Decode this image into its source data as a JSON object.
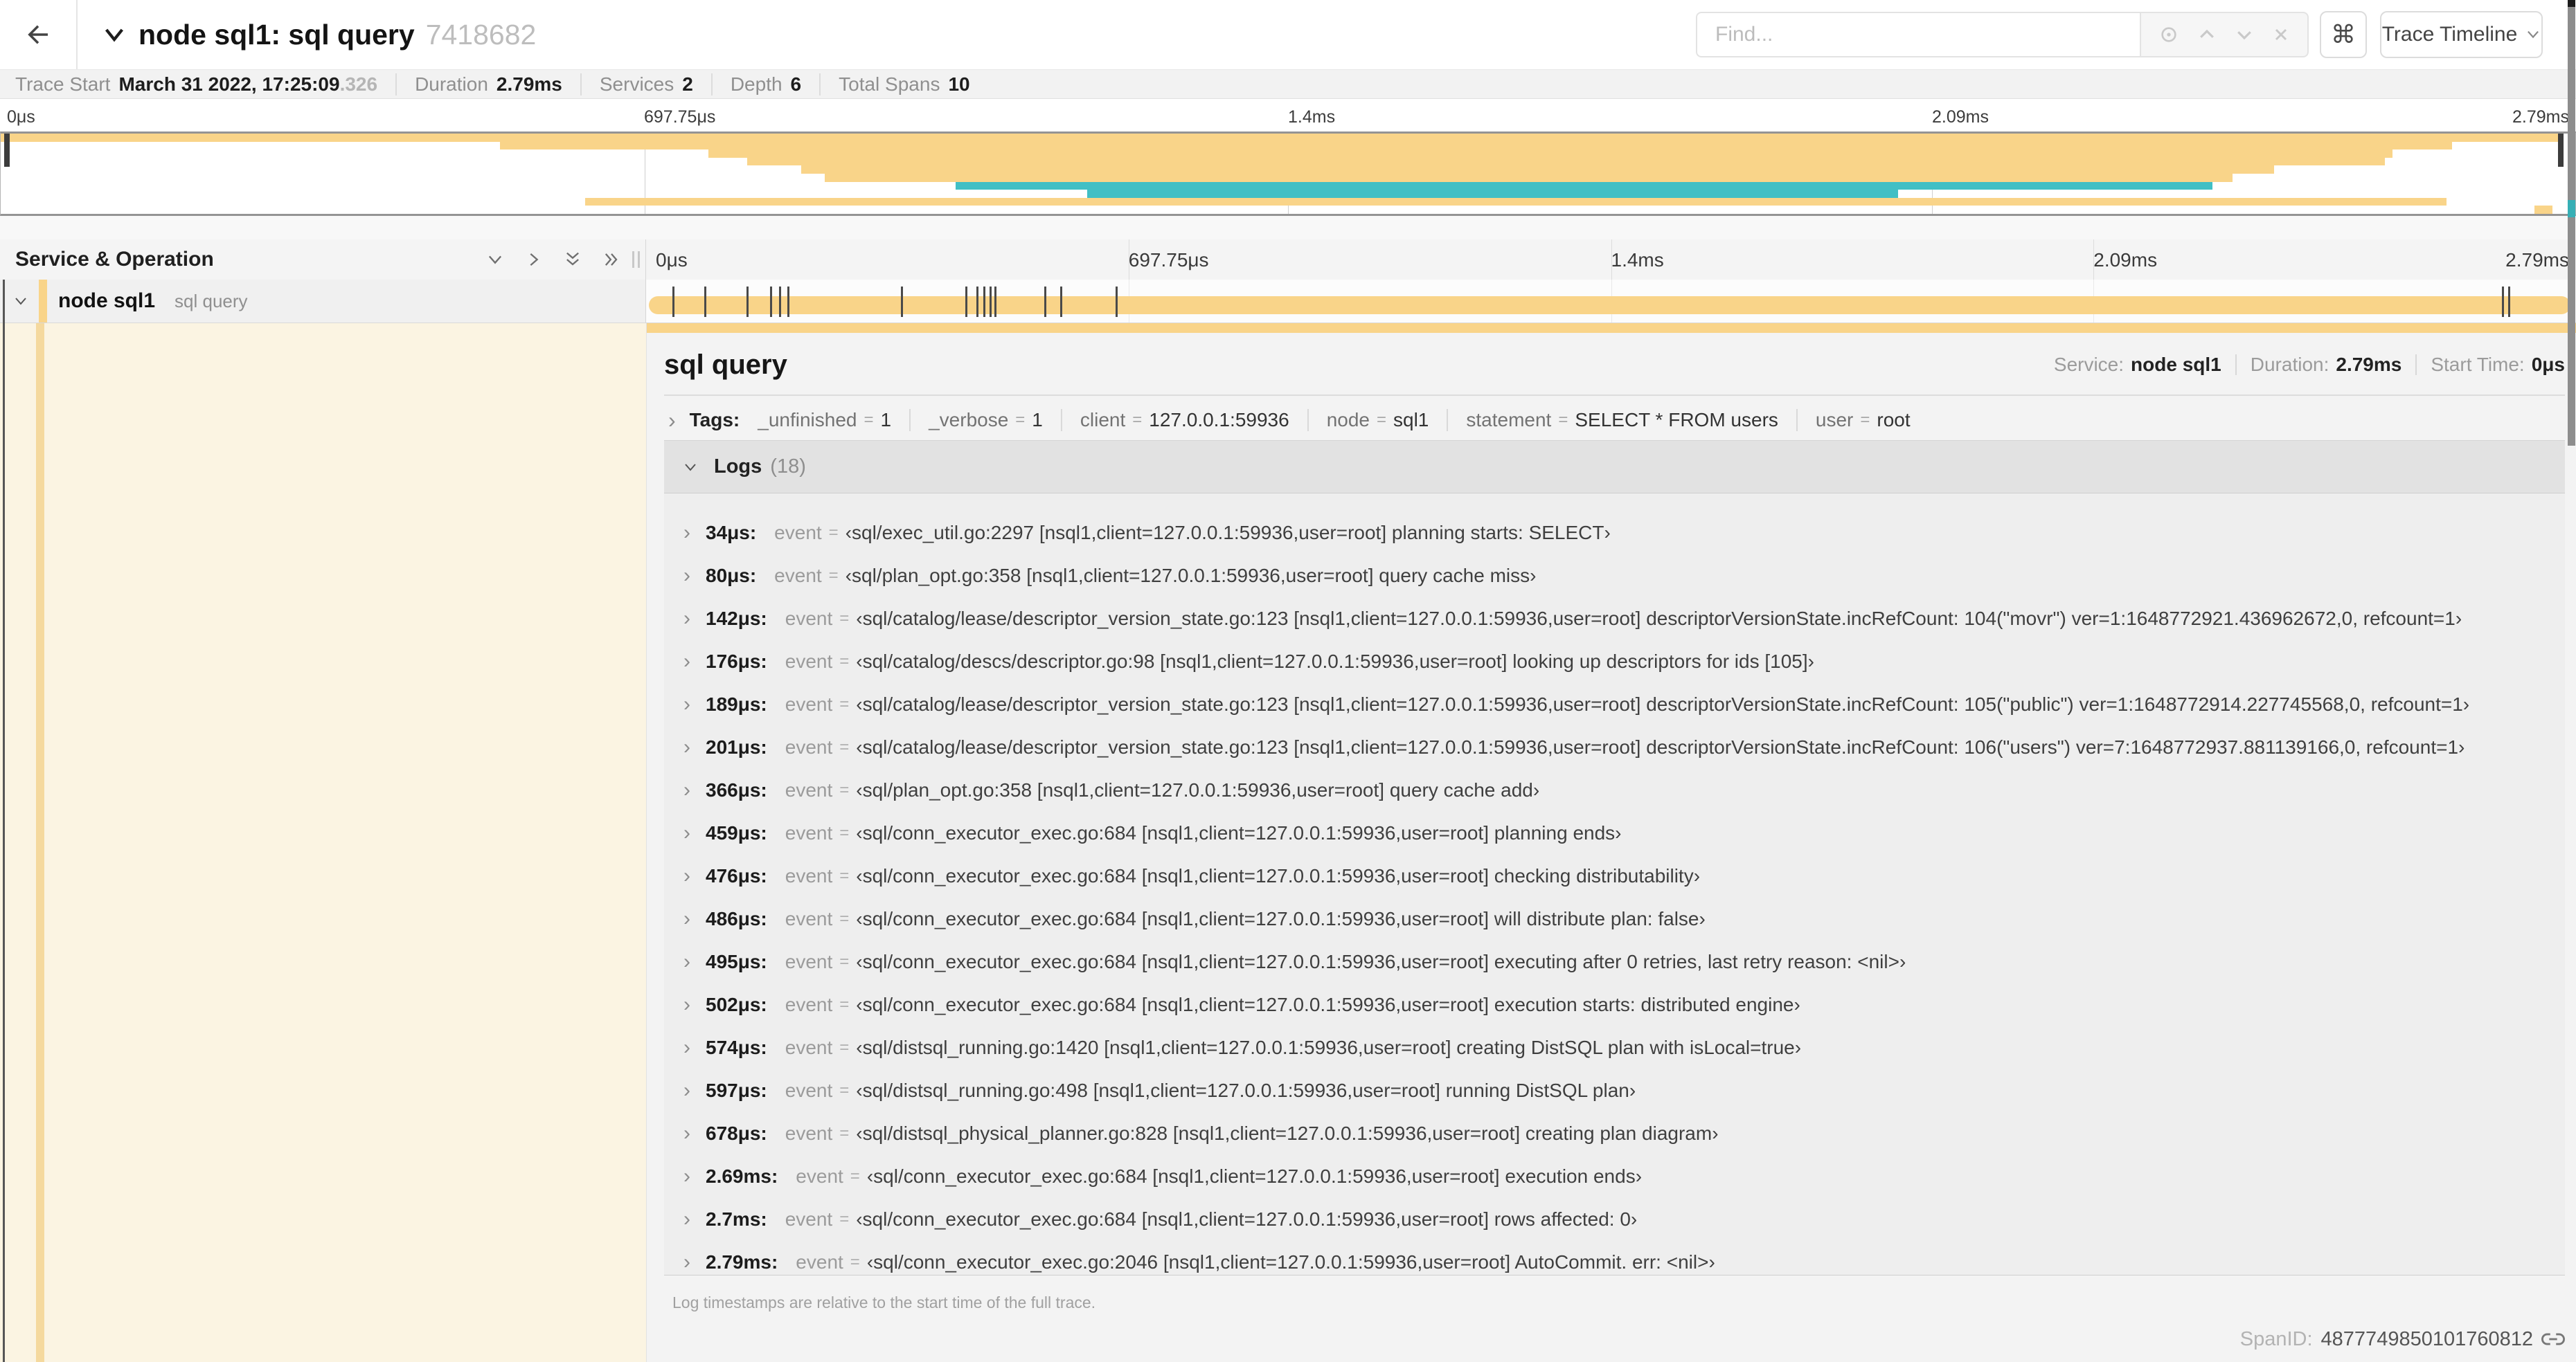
{
  "colors": {
    "tan": "#f9d489",
    "teal": "#41bfc5",
    "cream": "#fbf4e2"
  },
  "header": {
    "back_icon": "arrow-left",
    "collapse_icon": "chevron-down",
    "title": "node sql1: sql query",
    "trace_id": "7418682",
    "find_placeholder": "Find...",
    "shortcut_icon": "⌘",
    "view_selector": "Trace Timeline"
  },
  "trace_meta": {
    "items": [
      {
        "label": "Trace Start",
        "value": "March 31 2022, 17:25:09",
        "suffix": ".326"
      },
      {
        "label": "Duration",
        "value": "2.79ms"
      },
      {
        "label": "Services",
        "value": "2"
      },
      {
        "label": "Depth",
        "value": "6"
      },
      {
        "label": "Total Spans",
        "value": "10"
      }
    ]
  },
  "timeline": {
    "axis_ticks": [
      "0μs",
      "697.75μs",
      "1.4ms",
      "2.09ms",
      "2.79ms"
    ]
  },
  "minimap": {
    "bars": [
      {
        "start": 0,
        "end": 99.5,
        "color": "tan"
      },
      {
        "start": 19.4,
        "end": 95.2,
        "color": "tan"
      },
      {
        "start": 27.5,
        "end": 92.9,
        "color": "tan"
      },
      {
        "start": 29.0,
        "end": 92.6,
        "color": "tan"
      },
      {
        "start": 31.1,
        "end": 88.3,
        "color": "tan"
      },
      {
        "start": 32.0,
        "end": 86.7,
        "color": "tan"
      },
      {
        "start": 37.1,
        "end": 85.9,
        "color": "teal"
      },
      {
        "start": 42.2,
        "end": 73.7,
        "color": "teal"
      },
      {
        "start": 22.7,
        "end": 95.0,
        "color": "tan"
      },
      {
        "start": 98.4,
        "end": 99.1,
        "color": "tan"
      }
    ]
  },
  "timeline_header": {
    "title": "Service & Operation"
  },
  "span_row": {
    "service": "node sql1",
    "operation": "sql query",
    "duration_us": 2790,
    "log_marks_us": [
      34,
      80,
      142,
      176,
      189,
      201,
      366,
      459,
      476,
      486,
      495,
      502,
      574,
      597,
      678,
      2690,
      2700,
      2790
    ]
  },
  "detail": {
    "operation": "sql query",
    "meta": [
      {
        "label": "Service:",
        "value": "node sql1"
      },
      {
        "label": "Duration:",
        "value": "2.79ms"
      },
      {
        "label": "Start Time:",
        "value": "0μs"
      }
    ],
    "tags": {
      "label": "Tags:",
      "items": [
        {
          "key": "_unfinished",
          "value": "1"
        },
        {
          "key": "_verbose",
          "value": "1"
        },
        {
          "key": "client",
          "value": "127.0.0.1:59936"
        },
        {
          "key": "node",
          "value": "sql1"
        },
        {
          "key": "statement",
          "value": "SELECT * FROM users"
        },
        {
          "key": "user",
          "value": "root"
        }
      ]
    },
    "logs": {
      "title": "Logs",
      "count": "(18)",
      "entries": [
        {
          "time": "34μs:",
          "key": "event",
          "value": "‹sql/exec_util.go:2297 [nsql1,client=127.0.0.1:59936,user=root] planning starts: SELECT›"
        },
        {
          "time": "80μs:",
          "key": "event",
          "value": "‹sql/plan_opt.go:358 [nsql1,client=127.0.0.1:59936,user=root] query cache miss›"
        },
        {
          "time": "142μs:",
          "key": "event",
          "value": "‹sql/catalog/lease/descriptor_version_state.go:123 [nsql1,client=127.0.0.1:59936,user=root] descriptorVersionState.incRefCount: 104(\"movr\") ver=1:1648772921.436962672,0, refcount=1›"
        },
        {
          "time": "176μs:",
          "key": "event",
          "value": "‹sql/catalog/descs/descriptor.go:98 [nsql1,client=127.0.0.1:59936,user=root] looking up descriptors for ids [105]›"
        },
        {
          "time": "189μs:",
          "key": "event",
          "value": "‹sql/catalog/lease/descriptor_version_state.go:123 [nsql1,client=127.0.0.1:59936,user=root] descriptorVersionState.incRefCount: 105(\"public\") ver=1:1648772914.227745568,0, refcount=1›"
        },
        {
          "time": "201μs:",
          "key": "event",
          "value": "‹sql/catalog/lease/descriptor_version_state.go:123 [nsql1,client=127.0.0.1:59936,user=root] descriptorVersionState.incRefCount: 106(\"users\") ver=7:1648772937.881139166,0, refcount=1›"
        },
        {
          "time": "366μs:",
          "key": "event",
          "value": "‹sql/plan_opt.go:358 [nsql1,client=127.0.0.1:59936,user=root] query cache add›"
        },
        {
          "time": "459μs:",
          "key": "event",
          "value": "‹sql/conn_executor_exec.go:684 [nsql1,client=127.0.0.1:59936,user=root] planning ends›"
        },
        {
          "time": "476μs:",
          "key": "event",
          "value": "‹sql/conn_executor_exec.go:684 [nsql1,client=127.0.0.1:59936,user=root] checking distributability›"
        },
        {
          "time": "486μs:",
          "key": "event",
          "value": "‹sql/conn_executor_exec.go:684 [nsql1,client=127.0.0.1:59936,user=root] will distribute plan: false›"
        },
        {
          "time": "495μs:",
          "key": "event",
          "value": "‹sql/conn_executor_exec.go:684 [nsql1,client=127.0.0.1:59936,user=root] executing after 0 retries, last retry reason: <nil>›"
        },
        {
          "time": "502μs:",
          "key": "event",
          "value": "‹sql/conn_executor_exec.go:684 [nsql1,client=127.0.0.1:59936,user=root] execution starts: distributed engine›"
        },
        {
          "time": "574μs:",
          "key": "event",
          "value": "‹sql/distsql_running.go:1420 [nsql1,client=127.0.0.1:59936,user=root] creating DistSQL plan with isLocal=true›"
        },
        {
          "time": "597μs:",
          "key": "event",
          "value": "‹sql/distsql_running.go:498 [nsql1,client=127.0.0.1:59936,user=root] running DistSQL plan›"
        },
        {
          "time": "678μs:",
          "key": "event",
          "value": "‹sql/distsql_physical_planner.go:828 [nsql1,client=127.0.0.1:59936,user=root] creating plan diagram›"
        },
        {
          "time": "2.69ms:",
          "key": "event",
          "value": "‹sql/conn_executor_exec.go:684 [nsql1,client=127.0.0.1:59936,user=root] execution ends›"
        },
        {
          "time": "2.7ms:",
          "key": "event",
          "value": "‹sql/conn_executor_exec.go:684 [nsql1,client=127.0.0.1:59936,user=root] rows affected: 0›"
        },
        {
          "time": "2.79ms:",
          "key": "event",
          "value": "‹sql/conn_executor_exec.go:2046 [nsql1,client=127.0.0.1:59936,user=root] AutoCommit. err: <nil>›"
        }
      ],
      "footnote": "Log timestamps are relative to the start time of the full trace."
    },
    "span_id_label": "SpanID:",
    "span_id": "4877749850101760812"
  }
}
